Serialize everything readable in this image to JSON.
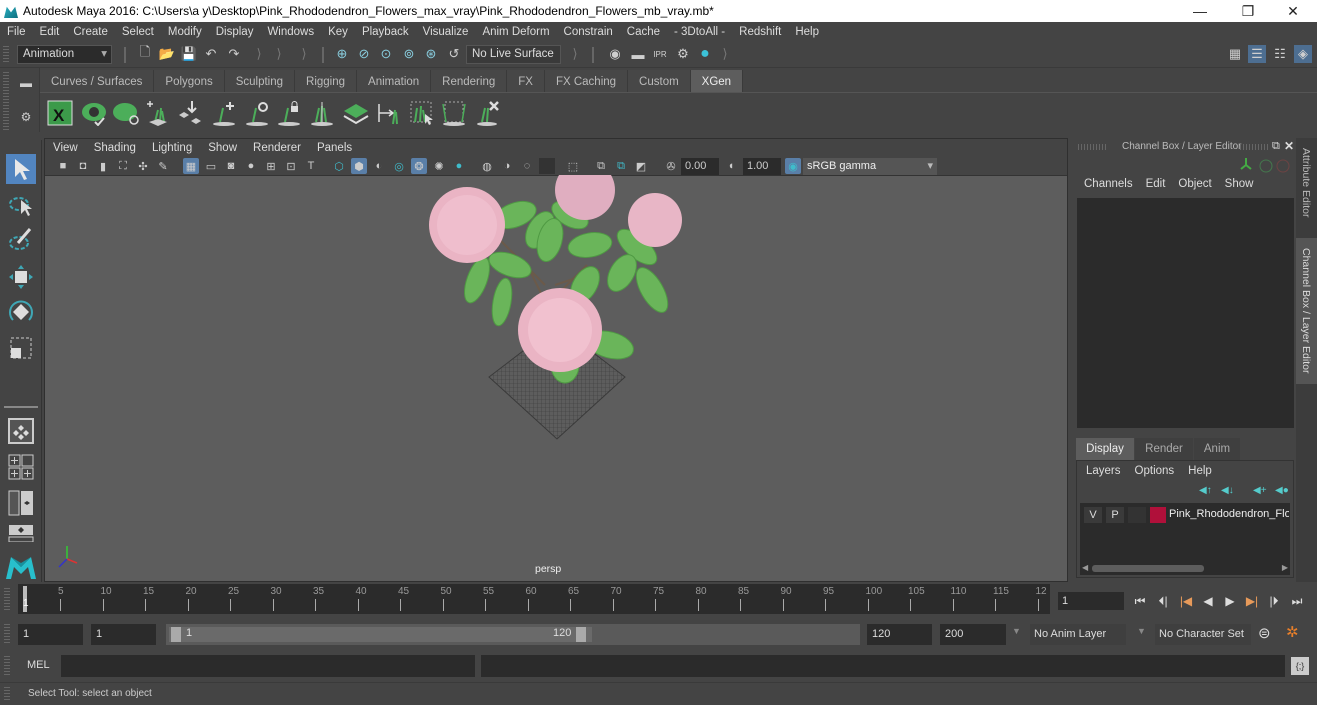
{
  "window": {
    "title": "Autodesk Maya 2016: C:\\Users\\a y\\Desktop\\Pink_Rhododendron_Flowers_max_vray\\Pink_Rhododendron_Flowers_mb_vray.mb*",
    "minimize": "—",
    "restore": "❐",
    "close": "✕"
  },
  "menubar": [
    "File",
    "Edit",
    "Create",
    "Select",
    "Modify",
    "Display",
    "Windows",
    "Key",
    "Playback",
    "Visualize",
    "Anim Deform",
    "Constrain",
    "Cache",
    "- 3DtoAll -",
    "Redshift",
    "Help"
  ],
  "statusline": {
    "menuset": "Animation",
    "live_surface": "No Live Surface"
  },
  "shelf": {
    "tabs": [
      "Curves / Surfaces",
      "Polygons",
      "Sculpting",
      "Rigging",
      "Animation",
      "Rendering",
      "FX",
      "FX Caching",
      "Custom",
      "XGen"
    ],
    "active_tab": "XGen",
    "icons": [
      "xgen-window-icon",
      "xgen-preview-icon",
      "xgen-hide-icon",
      "add-guides-icon",
      "move-guides-icon",
      "add-guide-icon",
      "guide-visibility-icon",
      "lock-guide-icon",
      "guide-split-icon",
      "xgen-layer-icon",
      "guide-length-icon",
      "select-guides-icon",
      "guide-bounds-icon",
      "delete-guides-icon"
    ]
  },
  "viewport": {
    "menu": [
      "View",
      "Shading",
      "Lighting",
      "Show",
      "Renderer",
      "Panels"
    ],
    "exposure": "0.00",
    "gamma": "1.00",
    "color_space": "sRGB gamma",
    "camera_label": "persp"
  },
  "channel_box": {
    "title": "Channel Box / Layer Editor",
    "menu": [
      "Channels",
      "Edit",
      "Object",
      "Show"
    ],
    "layer_tabs": [
      "Display",
      "Render",
      "Anim"
    ],
    "active_layer_tab": "Display",
    "layer_menu": [
      "Layers",
      "Options",
      "Help"
    ],
    "layers": [
      {
        "v": "V",
        "p": "P",
        "color": "#b0103a",
        "name": "Pink_Rhododendron_Flo"
      }
    ]
  },
  "side_tabs": {
    "attribute_editor": "Attribute Editor",
    "channel_box": "Channel Box / Layer Editor"
  },
  "timeline": {
    "ticks": [
      "5",
      "10",
      "15",
      "20",
      "25",
      "30",
      "35",
      "40",
      "45",
      "50",
      "55",
      "60",
      "65",
      "70",
      "75",
      "80",
      "85",
      "90",
      "95",
      "100",
      "105",
      "110",
      "115",
      "12"
    ],
    "current_marker": "1",
    "current_frame": "1"
  },
  "range": {
    "start": "1",
    "playback_start": "1",
    "slider_min": "1",
    "slider_max": "120",
    "playback_end": "120",
    "end": "200",
    "anim_layer": "No Anim Layer",
    "character_set": "No Character Set"
  },
  "command": {
    "mel_label": "MEL",
    "mel_value": ""
  },
  "help_line": "Select Tool: select an object"
}
